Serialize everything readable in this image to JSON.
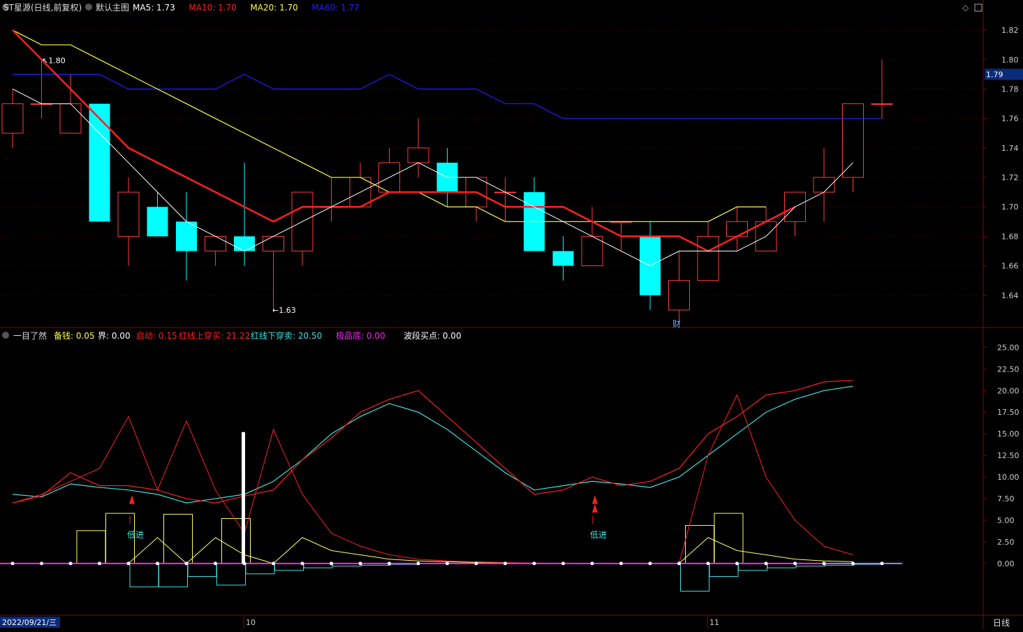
{
  "header": {
    "title": "ST星源(日线,前复权)",
    "main_chart_toggle": "默认主图",
    "ma_labels": [
      {
        "label": "MA5:",
        "value": "1.73",
        "color": "#ffffff"
      },
      {
        "label": "MA10:",
        "value": "1.70",
        "color": "#ff2020"
      },
      {
        "label": "MA20:",
        "value": "1.70",
        "color": "#ffff40"
      },
      {
        "label": "MA60:",
        "value": "1.77",
        "color": "#2020ff"
      }
    ]
  },
  "sub_header": {
    "title": "一目了然",
    "items": [
      {
        "label": "备钱:",
        "value": "0.05",
        "color": "#ffff40"
      },
      {
        "label": "界:",
        "value": "0.00",
        "color": "#ffffff"
      },
      {
        "label": "启动:",
        "value": "0.15",
        "color": "#ff2020"
      },
      {
        "label": "红线上穿买:",
        "value": "21.22",
        "color": "#ff2020"
      },
      {
        "label": "红线下穿卖:",
        "value": "20.50",
        "color": "#40e0e0"
      },
      {
        "label": "极品底:",
        "value": "0.00",
        "color": "#ff20ff"
      },
      {
        "label": "波段买点:",
        "value": "0.00",
        "color": "#ffffff"
      }
    ]
  },
  "price_axis": {
    "ticks": [
      "1.82",
      "1.80",
      "1.78",
      "1.76",
      "1.74",
      "1.72",
      "1.70",
      "1.68",
      "1.66",
      "1.64"
    ],
    "current": "1.79"
  },
  "indicator_axis": {
    "ticks": [
      "25.00",
      "22.50",
      "20.00",
      "17.50",
      "15.00",
      "12.50",
      "10.00",
      "7.50",
      "5.00",
      "2.50",
      "0.00"
    ]
  },
  "date_axis": {
    "cursor_date": "2022/09/21/三",
    "month_labels": [
      "10",
      "11"
    ],
    "period": "日线"
  },
  "annotations": {
    "high_label": "1.80",
    "low_label": "1.63",
    "cai_label": "财",
    "low_entry_label": "低进"
  },
  "chart_data": {
    "type": "candlestick",
    "ylim": [
      1.62,
      1.83
    ],
    "candles": [
      {
        "o": 1.75,
        "h": 1.78,
        "l": 1.74,
        "c": 1.77
      },
      {
        "o": 1.77,
        "h": 1.8,
        "l": 1.76,
        "c": 1.77
      },
      {
        "o": 1.75,
        "h": 1.79,
        "l": 1.76,
        "c": 1.77
      },
      {
        "o": 1.77,
        "h": 1.77,
        "l": 1.69,
        "c": 1.69
      },
      {
        "o": 1.68,
        "h": 1.72,
        "l": 1.66,
        "c": 1.71
      },
      {
        "o": 1.7,
        "h": 1.71,
        "l": 1.68,
        "c": 1.68
      },
      {
        "o": 1.69,
        "h": 1.71,
        "l": 1.65,
        "c": 1.67
      },
      {
        "o": 1.67,
        "h": 1.68,
        "l": 1.66,
        "c": 1.68
      },
      {
        "o": 1.68,
        "h": 1.73,
        "l": 1.66,
        "c": 1.67
      },
      {
        "o": 1.67,
        "h": 1.68,
        "l": 1.63,
        "c": 1.68
      },
      {
        "o": 1.67,
        "h": 1.71,
        "l": 1.66,
        "c": 1.71
      },
      {
        "o": 1.7,
        "h": 1.72,
        "l": 1.69,
        "c": 1.7
      },
      {
        "o": 1.7,
        "h": 1.73,
        "l": 1.7,
        "c": 1.72
      },
      {
        "o": 1.71,
        "h": 1.74,
        "l": 1.71,
        "c": 1.73
      },
      {
        "o": 1.73,
        "h": 1.76,
        "l": 1.72,
        "c": 1.74
      },
      {
        "o": 1.73,
        "h": 1.74,
        "l": 1.7,
        "c": 1.71
      },
      {
        "o": 1.7,
        "h": 1.72,
        "l": 1.69,
        "c": 1.72
      },
      {
        "o": 1.71,
        "h": 1.72,
        "l": 1.69,
        "c": 1.71
      },
      {
        "o": 1.71,
        "h": 1.72,
        "l": 1.67,
        "c": 1.67
      },
      {
        "o": 1.67,
        "h": 1.68,
        "l": 1.65,
        "c": 1.66
      },
      {
        "o": 1.66,
        "h": 1.7,
        "l": 1.66,
        "c": 1.68
      },
      {
        "o": 1.69,
        "h": 1.69,
        "l": 1.67,
        "c": 1.69
      },
      {
        "o": 1.68,
        "h": 1.69,
        "l": 1.63,
        "c": 1.64
      },
      {
        "o": 1.63,
        "h": 1.67,
        "l": 1.62,
        "c": 1.65
      },
      {
        "o": 1.65,
        "h": 1.69,
        "l": 1.65,
        "c": 1.68
      },
      {
        "o": 1.68,
        "h": 1.7,
        "l": 1.67,
        "c": 1.69
      },
      {
        "o": 1.67,
        "h": 1.7,
        "l": 1.67,
        "c": 1.69
      },
      {
        "o": 1.69,
        "h": 1.71,
        "l": 1.68,
        "c": 1.71
      },
      {
        "o": 1.71,
        "h": 1.74,
        "l": 1.69,
        "c": 1.72
      },
      {
        "o": 1.72,
        "h": 1.77,
        "l": 1.71,
        "c": 1.77
      },
      {
        "o": 1.77,
        "h": 1.8,
        "l": 1.76,
        "c": 1.77
      }
    ],
    "ma5": [
      1.78,
      1.77,
      1.77,
      1.75,
      1.73,
      1.71,
      1.69,
      1.68,
      1.67,
      1.68,
      1.69,
      1.7,
      1.71,
      1.72,
      1.73,
      1.72,
      1.72,
      1.71,
      1.7,
      1.69,
      1.68,
      1.67,
      1.66,
      1.67,
      1.67,
      1.67,
      1.68,
      1.7,
      1.71,
      1.73
    ],
    "ma10": [
      1.82,
      1.8,
      1.78,
      1.76,
      1.74,
      1.73,
      1.72,
      1.71,
      1.7,
      1.69,
      1.7,
      1.7,
      1.7,
      1.71,
      1.71,
      1.71,
      1.71,
      1.7,
      1.7,
      1.7,
      1.69,
      1.68,
      1.68,
      1.68,
      1.67,
      1.68,
      1.69,
      1.7
    ],
    "ma20": [
      1.82,
      1.81,
      1.81,
      1.8,
      1.79,
      1.78,
      1.77,
      1.76,
      1.75,
      1.74,
      1.73,
      1.72,
      1.72,
      1.71,
      1.71,
      1.7,
      1.7,
      1.69,
      1.69,
      1.69,
      1.69,
      1.69,
      1.69,
      1.69,
      1.69,
      1.7,
      1.7
    ],
    "ma60": [
      1.79,
      1.79,
      1.79,
      1.79,
      1.78,
      1.78,
      1.78,
      1.78,
      1.79,
      1.78,
      1.78,
      1.78,
      1.78,
      1.79,
      1.78,
      1.78,
      1.78,
      1.77,
      1.77,
      1.76,
      1.76,
      1.76,
      1.76,
      1.76,
      1.76,
      1.76,
      1.76,
      1.76,
      1.76,
      1.76,
      1.76
    ],
    "indicator": {
      "ylim": [
        -5.5,
        26
      ],
      "red_zigzag": [
        7.0,
        8.0,
        9.5,
        11.0,
        17.0,
        8.5,
        16.5,
        8.5,
        3.5,
        15.5,
        8.0,
        3.5,
        2.0,
        1.0,
        0.5,
        0.3,
        0.2,
        0.1,
        0.05,
        0.0,
        0.0,
        0.0,
        0.0,
        0.0,
        12.5,
        19.5,
        10.0,
        5.0,
        2.0,
        1.0,
        0.5,
        0.3,
        0.2,
        0.1
      ],
      "red_smooth": [
        7.0,
        7.8,
        10.5,
        9.0,
        9.0,
        8.5,
        7.5,
        7.0,
        7.8,
        8.5,
        12.0,
        14.5,
        17.5,
        19.0,
        20.0,
        17.0,
        14.0,
        11.0,
        8.0,
        8.5,
        10.0,
        9.0,
        9.5,
        11.0,
        15.0,
        17.0,
        19.5,
        20.0,
        21.0,
        21.2
      ],
      "cyan_smooth": [
        8.0,
        7.7,
        9.2,
        8.8,
        8.5,
        8.0,
        7.0,
        7.5,
        8.0,
        9.5,
        12.0,
        15.0,
        17.0,
        18.5,
        17.5,
        15.5,
        13.0,
        10.5,
        8.5,
        9.0,
        9.5,
        9.2,
        8.8,
        10.0,
        12.5,
        15.0,
        17.5,
        19.0,
        20.0,
        20.5
      ],
      "yellow_zigzag": [
        0,
        0,
        0,
        0,
        0,
        3.0,
        0,
        3.0,
        1.0,
        0,
        3.0,
        1.5,
        1.0,
        0.5,
        0.3,
        0.2,
        0.1,
        0.05,
        0,
        0,
        0,
        0,
        0,
        0,
        3.0,
        1.5,
        1.0,
        0.5,
        0.3,
        0.2
      ],
      "yellow_boxes": [
        3.8,
        5.8,
        0,
        5.7,
        0,
        5.2,
        0,
        0,
        0,
        0,
        0,
        0,
        0,
        0,
        0,
        0,
        0,
        0,
        0,
        0,
        0,
        4.4,
        5.8,
        0,
        0,
        0,
        0,
        0,
        0,
        0
      ],
      "cyan_boxes": [
        0,
        0,
        0,
        0,
        -2.7,
        -2.7,
        -1.5,
        -2.5,
        -1.2,
        -0.8,
        -0.5,
        -0.3,
        -0.2,
        -0.1,
        0,
        0,
        0,
        0,
        0,
        0,
        0,
        0,
        0,
        -3.2,
        -1.5,
        -0.8,
        -0.5,
        -0.3,
        -0.2,
        -0.1
      ]
    }
  }
}
